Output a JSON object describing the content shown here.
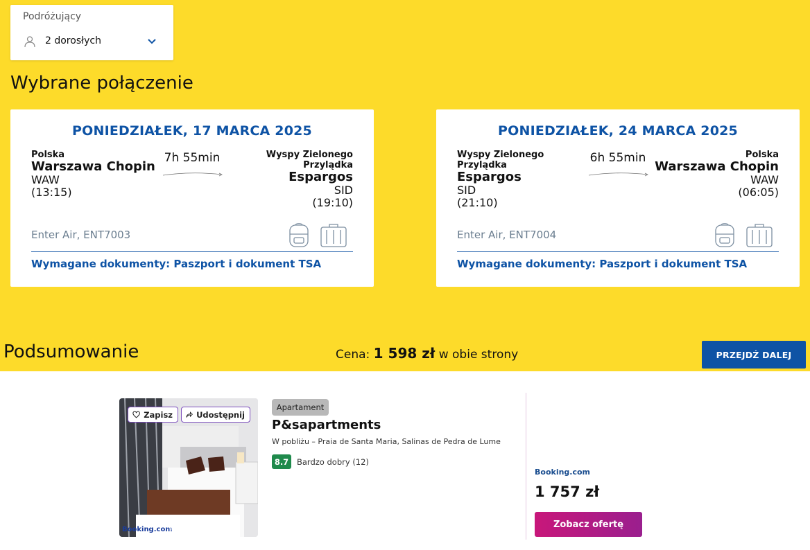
{
  "travellers": {
    "label": "Podróżujący",
    "value": "2 dorosłych"
  },
  "selected_connection_title": "Wybrane połączenie",
  "flights": [
    {
      "date": "PONIEDZIAŁEK, 17 MARCA 2025",
      "from": {
        "country": "Polska",
        "city": "Warszawa Chopin",
        "code": "WAW",
        "time": "(13:15)"
      },
      "to": {
        "country_line1": "Wyspy Zielonego",
        "country_line2": "Przylądka",
        "city": "Espargos",
        "code": "SID",
        "time": "(19:10)"
      },
      "duration": "7h 55min",
      "carrier": "Enter Air, ENT7003",
      "documents": "Wymagane dokumenty: Paszport i dokument TSA"
    },
    {
      "date": "PONIEDZIAŁEK, 24 MARCA 2025",
      "from": {
        "country_line1": "Wyspy Zielonego",
        "country_line2": "Przylądka",
        "city": "Espargos",
        "code": "SID",
        "time": "(21:10)"
      },
      "to": {
        "country": "Polska",
        "city": "Warszawa Chopin",
        "code": "WAW",
        "time": "(06:05)"
      },
      "duration": "6h 55min",
      "carrier": "Enter Air, ENT7004",
      "documents": "Wymagane dokumenty: Paszport i dokument TSA"
    }
  ],
  "summary": {
    "title": "Podsumowanie",
    "price_label": "Cena:",
    "price_value": "1 598 zł",
    "price_suffix": "w obie strony",
    "next_button": "PRZEJDŹ DALEJ"
  },
  "hotel": {
    "save_label": "Zapisz",
    "share_label": "Udostępnij",
    "image_logo": "Booking.com",
    "type": "Apartament",
    "name": "P&sapartments",
    "location": "W pobliżu – Praia de Santa Maria, Salinas de Pedra de Lume",
    "score": "8.7",
    "score_label": "Bardzo dobry (12)",
    "provider": "Booking.com",
    "price": "1 757 zł",
    "offer_button": "Zobacz ofertę"
  },
  "colors": {
    "background_yellow": "#fddb2a",
    "brand_blue": "#0e53a5",
    "score_green": "#1f8a4c",
    "offer_magenta": "#c8177a"
  },
  "icons": [
    "user-icon",
    "chevron-down-icon",
    "arrow-right-icon",
    "backpack-icon",
    "suitcase-icon",
    "heart-icon",
    "share-icon"
  ]
}
